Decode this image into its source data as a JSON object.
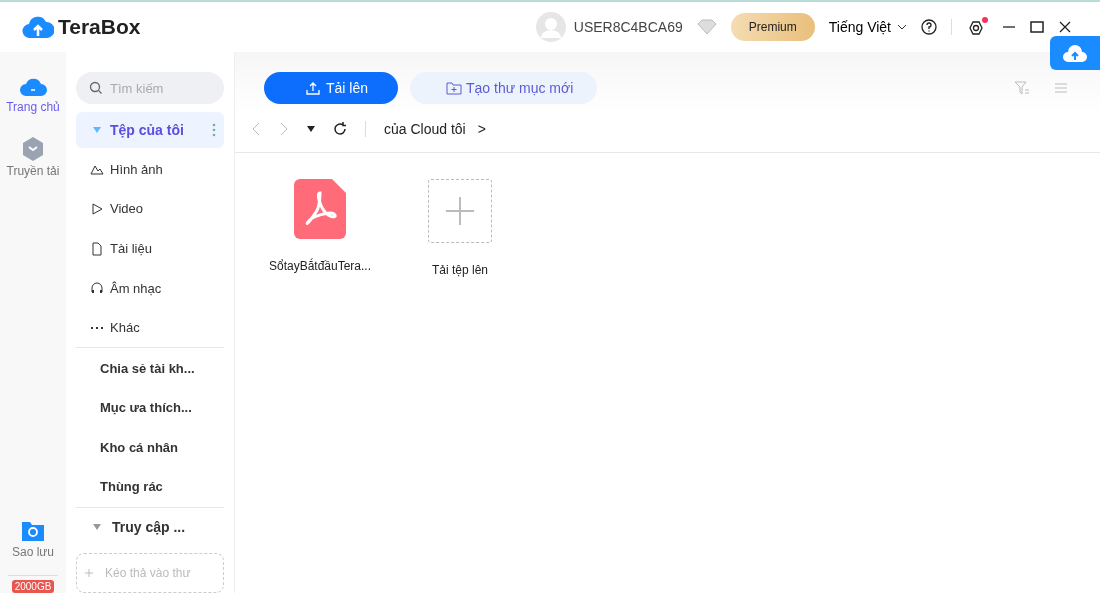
{
  "app": {
    "name": "TeraBox"
  },
  "header": {
    "username": "USER8C4BCA69",
    "premium": "Premium",
    "language": "Tiếng Việt"
  },
  "rail": [
    {
      "label": "Trang chủ",
      "selected": true
    },
    {
      "label": "Truyền tải",
      "selected": false
    },
    {
      "label": "Sao lưu",
      "selected": false
    }
  ],
  "storage_badge": "2000GB",
  "sidebar": {
    "search": {
      "placeholder": "Tìm kiếm"
    },
    "items": [
      {
        "kind": "root",
        "label": "Tệp của tôi",
        "selected": true
      },
      {
        "kind": "category",
        "label": "Hình ảnh",
        "selected": false
      },
      {
        "kind": "category",
        "label": "Video",
        "selected": false
      },
      {
        "kind": "category",
        "label": "Tài liệu",
        "selected": false
      },
      {
        "kind": "category",
        "label": "Âm nhạc",
        "selected": false
      },
      {
        "kind": "category",
        "label": "Khác",
        "selected": false
      },
      {
        "kind": "divider"
      },
      {
        "kind": "section",
        "label": "Chia sẻ tài kh...",
        "selected": false
      },
      {
        "kind": "section",
        "label": "Mục ưa thích...",
        "selected": false
      },
      {
        "kind": "section",
        "label": "Kho cá nhân",
        "selected": false
      },
      {
        "kind": "section",
        "label": "Thùng rác",
        "selected": false
      },
      {
        "kind": "divider"
      },
      {
        "kind": "group",
        "label": "Truy cập ...",
        "selected": false
      }
    ],
    "drop_hint": "Kéo thả vào thư"
  },
  "toolbar": {
    "upload": "Tải lên",
    "new_folder": "Tạo thư mục mới"
  },
  "breadcrumb": {
    "path": "của Cloud tôi",
    "separator": ">"
  },
  "files": [
    {
      "kind": "pdf",
      "name": "SổtayBắtđầuTera..."
    },
    {
      "kind": "upload",
      "name": "Tải tệp lên"
    }
  ]
}
